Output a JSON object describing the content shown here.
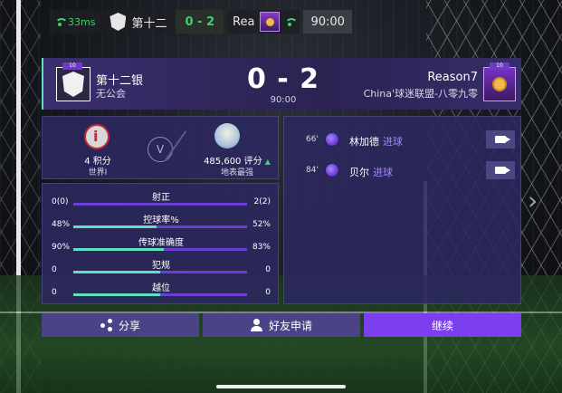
{
  "status_bar": {
    "ping": "33ms",
    "home_team_short": "第十二",
    "score": "0 - 2",
    "away_team_short": "Rea",
    "time": "90:00"
  },
  "header": {
    "home_name": "第十二银",
    "home_sub": "无公会",
    "score": "0 - 2",
    "time": "90:00",
    "away_name": "Reason7",
    "away_sub": "China'球迷联盟-八零九零",
    "home_badge": "10",
    "away_badge": "10"
  },
  "team_info": {
    "home_points": "4 积分",
    "home_rank": "世界I",
    "vs": "V",
    "away_rating": "485,600 评分",
    "away_rating_label": "地表最强"
  },
  "stats": [
    {
      "label": "射正",
      "home": "0(0)",
      "away": "2(2)",
      "home_share": 0.0
    },
    {
      "label": "控球率%",
      "home": "48%",
      "away": "52%",
      "home_share": 0.48
    },
    {
      "label": "传球准确度",
      "home": "90%",
      "away": "83%",
      "home_share": 0.52
    },
    {
      "label": "犯规",
      "home": "0",
      "away": "0",
      "home_share": 0.5
    },
    {
      "label": "越位",
      "home": "0",
      "away": "0",
      "home_share": 0.5
    }
  ],
  "events": [
    {
      "minute": "66'",
      "player": "林加德",
      "type": "进球"
    },
    {
      "minute": "84'",
      "player": "贝尔",
      "type": "进球"
    }
  ],
  "buttons": {
    "share": "分享",
    "friend": "好友申请",
    "continue": "继续"
  },
  "colors": {
    "accent_purple": "#7b3ff0",
    "bar_teal": "#5fe0c4",
    "bar_purple": "#6b3fd6",
    "ping_green": "#3ad36a"
  }
}
